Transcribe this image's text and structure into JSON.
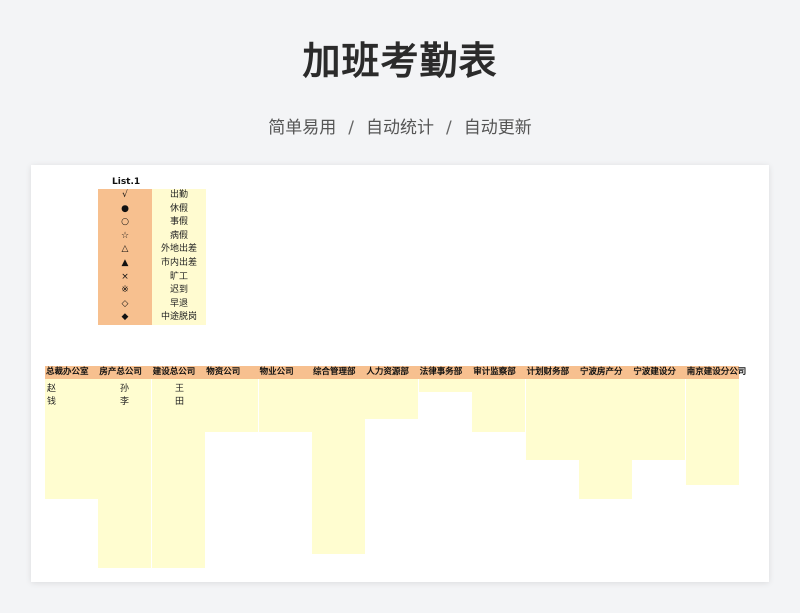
{
  "page": {
    "title": "加班考勤表",
    "subtitle_items": [
      "简单易用",
      "自动统计",
      "自动更新"
    ],
    "separator": "/"
  },
  "legend": {
    "title": "List.1",
    "items": [
      {
        "symbol": "√",
        "label": "出勤"
      },
      {
        "symbol": "●",
        "label": "休假"
      },
      {
        "symbol": "○",
        "label": "事假"
      },
      {
        "symbol": "☆",
        "label": "病假"
      },
      {
        "symbol": "△",
        "label": "外地出差"
      },
      {
        "symbol": "▲",
        "label": "市内出差"
      },
      {
        "symbol": "×",
        "label": "旷工"
      },
      {
        "symbol": "※",
        "label": "迟到"
      },
      {
        "symbol": "◇",
        "label": "早退"
      },
      {
        "symbol": "◆",
        "label": "中途脱岗"
      }
    ]
  },
  "table": {
    "headers": [
      "总裁办公室",
      "房产总公司",
      "建设总公司",
      "物资公司",
      "物业公司",
      "综合管理部",
      "人力资源部",
      "法律事务部",
      "审计监察部",
      "计划财务部",
      "宁波房产分",
      "宁波建设分",
      "南京建设分公司"
    ],
    "rows": [
      [
        "赵",
        "孙",
        "王"
      ],
      [
        "钱",
        "李",
        "田"
      ]
    ]
  },
  "colors": {
    "background": "#f3f4f6",
    "header_fill": "#f7c08f",
    "cell_fill": "#fffdd0",
    "legend_label_fill": "#fffbd0"
  }
}
